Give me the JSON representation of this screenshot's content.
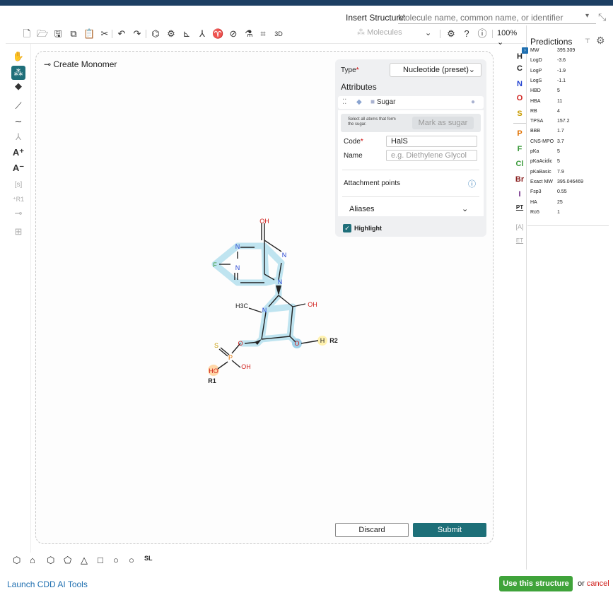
{
  "insert": {
    "label": "Insert Structure:",
    "placeholder": "Molecule name, common name, or identifier"
  },
  "toolbar": {
    "molecules_label": "Molecules",
    "zoom": "100%"
  },
  "canvas": {
    "create_monomer_label": "Create Monomer"
  },
  "panel": {
    "type_label": "Type",
    "type_value": "Nucleotide (preset)",
    "attributes_label": "Attributes",
    "sugar_tab_label": "Sugar",
    "hint_text": "Select all atoms that form the sugar.",
    "mark_button": "Mark as sugar",
    "code_label": "Code",
    "code_value": "HalS",
    "name_label": "Name",
    "name_placeholder": "e.g. Diethylene Glycol",
    "attachment_label": "Attachment points",
    "aliases_label": "Aliases",
    "highlight_label": "Highlight"
  },
  "molecule": {
    "atoms": {
      "oh_top": "OH",
      "n1": "N",
      "n2": "N",
      "n3": "N",
      "n4": "N",
      "f": "F",
      "nring": "N",
      "h3c": "H3C",
      "oh_right": "OH",
      "o_ring": "O",
      "o_h": "O",
      "h": "H",
      "r2": "R2",
      "s": "S",
      "p": "P",
      "oh_p": "OH",
      "ho": "HO",
      "r1": "R1",
      "o_link": "O"
    }
  },
  "buttons": {
    "discard": "Discard",
    "submit": "Submit",
    "use_structure": "Use this structure",
    "or": "or",
    "cancel": "cancel",
    "launch": "Launch CDD AI Tools"
  },
  "elements": [
    "H",
    "C",
    "N",
    "O",
    "S",
    "P",
    "F",
    "Cl",
    "Br",
    "I",
    "PT"
  ],
  "element_colors": {
    "H": "#222222",
    "C": "#222222",
    "N": "#2040d0",
    "O": "#d0201c",
    "S": "#c89b00",
    "P": "#e07000",
    "F": "#3a9a3a",
    "Cl": "#3a9a3a",
    "Br": "#8a2020",
    "I": "#6a2080",
    "PT": "#222222"
  },
  "predictions": {
    "title": "Predictions",
    "rows": [
      {
        "k": "MW",
        "v": "395.309"
      },
      {
        "k": "LogD",
        "v": "-3.6"
      },
      {
        "k": "LogP",
        "v": "-1.9"
      },
      {
        "k": "LogS",
        "v": "-1.1"
      },
      {
        "k": "HBD",
        "v": "5"
      },
      {
        "k": "HBA",
        "v": "11"
      },
      {
        "k": "RB",
        "v": "4"
      },
      {
        "k": "TPSA",
        "v": "157.2"
      },
      {
        "k": "BBB",
        "v": "1.7"
      },
      {
        "k": "CNS-MPO",
        "v": "3.7"
      },
      {
        "k": "pKa",
        "v": "5"
      },
      {
        "k": "pKaAcidic",
        "v": "5"
      },
      {
        "k": "pKaBasic",
        "v": "7.9"
      },
      {
        "k": "Exact MW",
        "v": "395.046469"
      },
      {
        "k": "Fsp3",
        "v": "0.55"
      },
      {
        "k": "HA",
        "v": "25"
      },
      {
        "k": "Ro5",
        "v": "1"
      }
    ]
  },
  "colors": {
    "accent": "#1d6f78",
    "use_green": "#3fa33a",
    "cancel_red": "#d0201c",
    "link_blue": "#1f6fb0"
  }
}
